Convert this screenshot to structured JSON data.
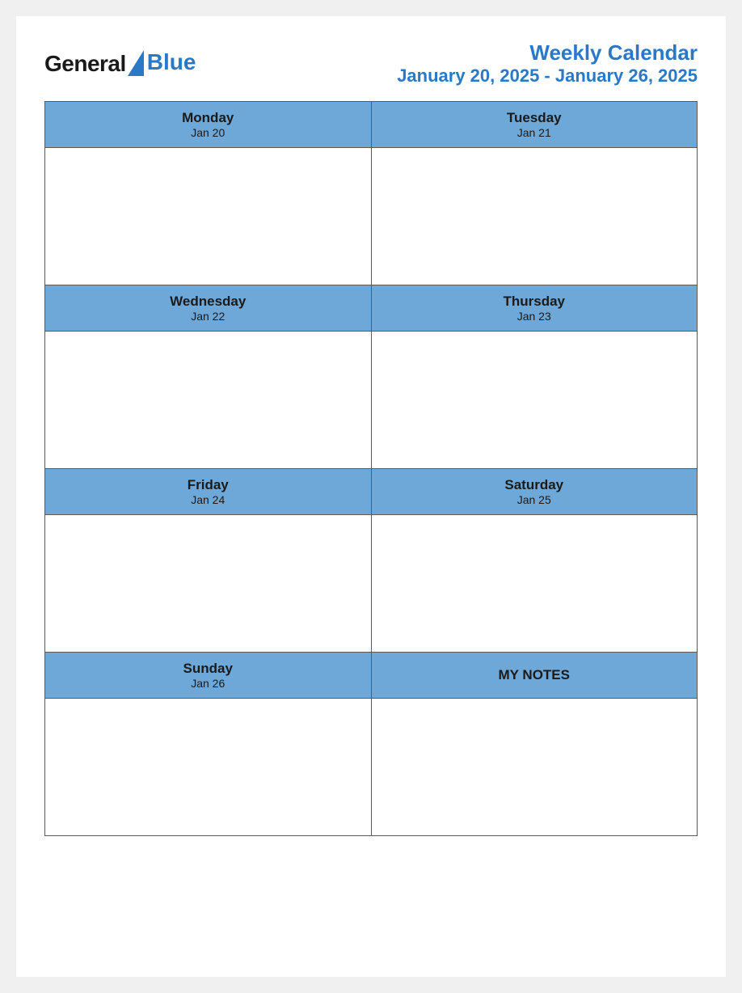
{
  "logo": {
    "general": "General",
    "blue": "Blue"
  },
  "header": {
    "title": "Weekly Calendar",
    "subtitle": "January 20, 2025 - January 26, 2025"
  },
  "days": [
    {
      "name": "Monday",
      "date": "Jan 20"
    },
    {
      "name": "Tuesday",
      "date": "Jan 21"
    },
    {
      "name": "Wednesday",
      "date": "Jan 22"
    },
    {
      "name": "Thursday",
      "date": "Jan 23"
    },
    {
      "name": "Friday",
      "date": "Jan 24"
    },
    {
      "name": "Saturday",
      "date": "Jan 25"
    },
    {
      "name": "Sunday",
      "date": "Jan 26"
    }
  ],
  "notes": {
    "label": "MY NOTES"
  }
}
